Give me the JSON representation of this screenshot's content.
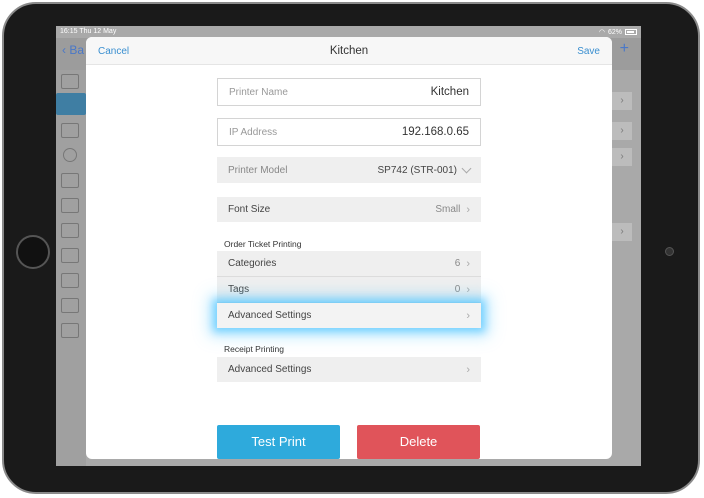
{
  "status_bar": {
    "time": "16:15",
    "date": "Thu 12 May",
    "battery": "62%"
  },
  "background": {
    "back_label": "Ba",
    "plus_label": "+"
  },
  "modal": {
    "cancel_label": "Cancel",
    "title": "Kitchen",
    "save_label": "Save"
  },
  "fields": {
    "printer_name": {
      "label": "Printer Name",
      "value": "Kitchen"
    },
    "ip_address": {
      "label": "IP Address",
      "value": "192.168.0.65"
    },
    "printer_model": {
      "label": "Printer Model",
      "value": "SP742 (STR-001)"
    },
    "font_size": {
      "label": "Font Size",
      "value": "Small"
    }
  },
  "order_ticket": {
    "title": "Order Ticket Printing",
    "categories": {
      "label": "Categories",
      "value": "6"
    },
    "tags": {
      "label": "Tags",
      "value": "0"
    },
    "advanced": {
      "label": "Advanced Settings"
    }
  },
  "receipt": {
    "title": "Receipt Printing",
    "advanced": {
      "label": "Advanced Settings"
    }
  },
  "buttons": {
    "test_print": "Test Print",
    "delete": "Delete"
  },
  "colors": {
    "accent": "#3a8fd0",
    "test_print": "#2eaadc",
    "delete": "#e0545a",
    "highlight": "#5ac8ff"
  }
}
